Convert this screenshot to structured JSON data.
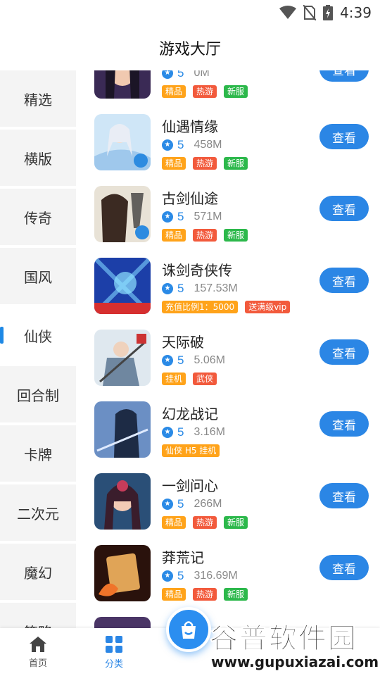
{
  "status_bar": {
    "time": "4:39"
  },
  "header": {
    "title": "游戏大厅"
  },
  "sidebar": {
    "items": [
      {
        "label": "精选"
      },
      {
        "label": "横版"
      },
      {
        "label": "传奇"
      },
      {
        "label": "国风"
      },
      {
        "label": "仙侠"
      },
      {
        "label": "回合制"
      },
      {
        "label": "卡牌"
      },
      {
        "label": "二次元"
      },
      {
        "label": "魔幻"
      },
      {
        "label": "策略"
      }
    ],
    "active_index": 4
  },
  "games": [
    {
      "name": "",
      "score": "5",
      "size": "0M",
      "tags": [
        "精品",
        "热游",
        "新服"
      ],
      "button": "查看"
    },
    {
      "name": "仙遇情缘",
      "score": "5",
      "size": "458M",
      "tags": [
        "精品",
        "热游",
        "新服"
      ],
      "button": "查看"
    },
    {
      "name": "古剑仙途",
      "score": "5",
      "size": "571M",
      "tags": [
        "精品",
        "热游",
        "新服"
      ],
      "button": "查看"
    },
    {
      "name": "诛剑奇侠传",
      "score": "5",
      "size": "157.53M",
      "tags": [
        "充值比例1：5000",
        "送满级vip"
      ],
      "button": "查看"
    },
    {
      "name": "天际破",
      "score": "5",
      "size": "5.06M",
      "tags": [
        "挂机",
        "武侠"
      ],
      "button": "查看"
    },
    {
      "name": "幻龙战记",
      "score": "5",
      "size": "3.16M",
      "tags": [
        "仙侠 H5 挂机"
      ],
      "button": "查看"
    },
    {
      "name": "一剑问心",
      "score": "5",
      "size": "266M",
      "tags": [
        "精品",
        "热游",
        "新服"
      ],
      "button": "查看"
    },
    {
      "name": "莽荒记",
      "score": "5",
      "size": "316.69M",
      "tags": [
        "精品",
        "热游",
        "新服"
      ],
      "button": "查看"
    }
  ],
  "bottom_nav": {
    "items": [
      {
        "label": "首页",
        "icon": "home-icon"
      },
      {
        "label": "分类",
        "icon": "grid-icon"
      }
    ]
  },
  "watermark": {
    "title": "谷普软件园",
    "url": "www.gupuxiazai.com"
  },
  "colors": {
    "accent": "#2b86e5",
    "tag_orange": "#ffa31a",
    "tag_red": "#f25a3c",
    "tag_green": "#2cb84b"
  }
}
